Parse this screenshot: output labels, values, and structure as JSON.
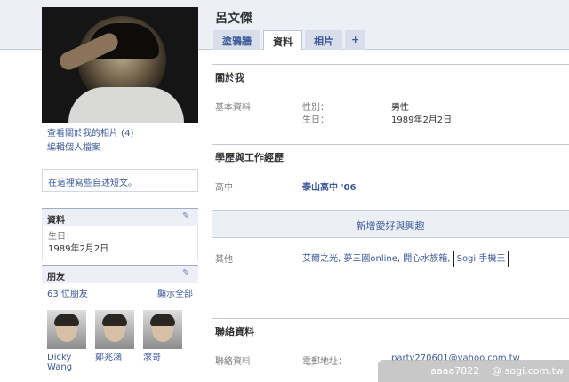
{
  "profile": {
    "name": "呂文傑"
  },
  "tabs": [
    {
      "label": "塗鴉牆"
    },
    {
      "label": "資料"
    },
    {
      "label": "相片"
    },
    {
      "label": "+"
    }
  ],
  "sidebar": {
    "photo_link": "查看關於我的相片 (4)",
    "edit_link": "編輯個人檔案",
    "status_prompt": "在這裡寫些自述短文。",
    "info_title": "資料",
    "birthday_label": "生日：",
    "birthday_value": "1989年2月2日",
    "friends_title": "朋友",
    "friends_count": "63 位朋友",
    "show_all": "顯示全部",
    "friends": [
      {
        "name": "Dicky Wang"
      },
      {
        "name": "鄭兆涵"
      },
      {
        "name": "滾哥"
      }
    ]
  },
  "about": {
    "title": "關於我",
    "basic_label": "基本資料",
    "gender_label": "性別：",
    "gender_value": "男性",
    "birthday_label": "生日：",
    "birthday_value": "1989年2月2日"
  },
  "education": {
    "title": "學歷與工作經歷",
    "hs_label": "高中",
    "school": "泰山高中 '06"
  },
  "interests": {
    "add_label": "新增愛好與興趣",
    "other_label": "其他",
    "items_text": "艾爾之光, 夢三國online, 開心水族箱,",
    "highlighted": "Sogi 手機王"
  },
  "contact": {
    "title": "聯絡資料",
    "label": "聯絡資料",
    "email_label": "電郵地址：",
    "email_value": "party270601@yahoo.com.tw"
  },
  "watermark": {
    "user": "aaaa7822",
    "site": "@ sogi.com.tw"
  }
}
